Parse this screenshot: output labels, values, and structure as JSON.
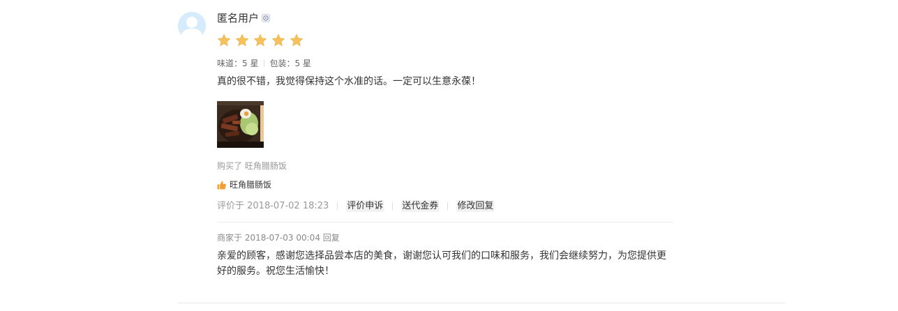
{
  "review": {
    "user_name": "匿名用户",
    "icons": {
      "avatar": "avatar-icon",
      "user_badge": "user-level-icon",
      "star": "star-icon",
      "thumb": "thumbs-up-icon"
    },
    "stars": 5,
    "max_stars": 5,
    "colors": {
      "star": "#f5c15a",
      "thumb": "#f0a030",
      "avatar_bg": "#d6ebfc"
    },
    "ratings": [
      {
        "text": "味道：5 星"
      },
      {
        "text": "包装：5 星"
      }
    ],
    "text": "真的很不错，我觉得保持这个水准的话。一定可以生意永葆！",
    "photo": {
      "alt": "food-photo"
    },
    "purchased": "购买了 旺角腊肠饭",
    "dish_tag": "旺角腊肠饭",
    "time": "评价于 2018-07-02 18:23",
    "actions": {
      "appeal": "评价申诉",
      "coupon": "送代金券",
      "edit_reply": "修改回复"
    },
    "merchant_reply": {
      "meta": "商家于 2018-07-03 00:04 回复",
      "text": "亲爱的顾客，感谢您选择品尝本店的美食，谢谢您认可我们的口味和服务，我们会继续努力，为您提供更好的服务。祝您生活愉快！"
    }
  }
}
